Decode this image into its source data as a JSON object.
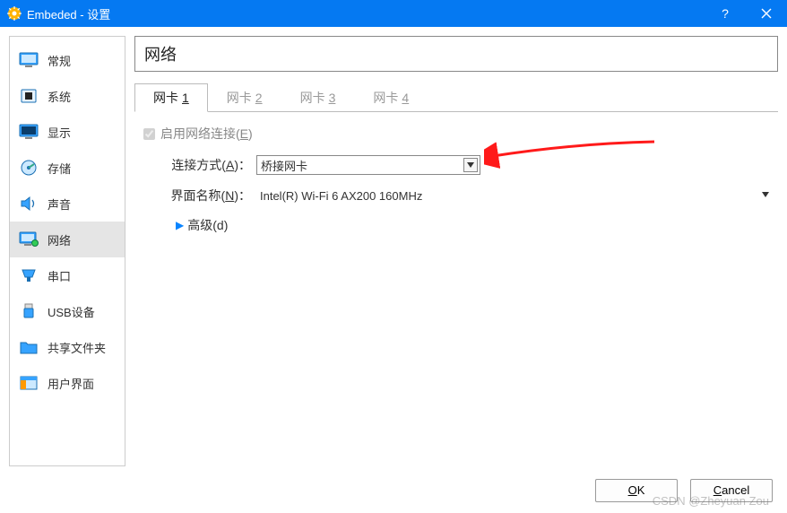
{
  "title": "Embeded - 设置",
  "sidebar": {
    "items": [
      {
        "label": "常规"
      },
      {
        "label": "系统"
      },
      {
        "label": "显示"
      },
      {
        "label": "存储"
      },
      {
        "label": "声音"
      },
      {
        "label": "网络"
      },
      {
        "label": "串口"
      },
      {
        "label": "USB设备"
      },
      {
        "label": "共享文件夹"
      },
      {
        "label": "用户界面"
      }
    ]
  },
  "main": {
    "heading": "网络",
    "tabs": [
      {
        "label": "网卡",
        "num": "1"
      },
      {
        "label": "网卡",
        "num": "2"
      },
      {
        "label": "网卡",
        "num": "3"
      },
      {
        "label": "网卡",
        "num": "4"
      }
    ],
    "enable_cb": {
      "text_pre": "启用网络连接(",
      "key": "E",
      "text_post": ")"
    },
    "attach_label": {
      "pre": "连接方式(",
      "key": "A",
      "post": ")："
    },
    "attach_value": "桥接网卡",
    "iface_label": {
      "pre": "界面名称(",
      "key": "N",
      "post": ")："
    },
    "iface_value": "Intel(R) Wi-Fi 6 AX200 160MHz",
    "advanced": {
      "pre": "高级(",
      "key": "d",
      "post": ")"
    }
  },
  "buttons": {
    "ok_pre": "O",
    "ok_post": "K",
    "cancel_pre": "C",
    "cancel_post": "ancel"
  },
  "watermark": "CSDN @Zheyuan Zou"
}
